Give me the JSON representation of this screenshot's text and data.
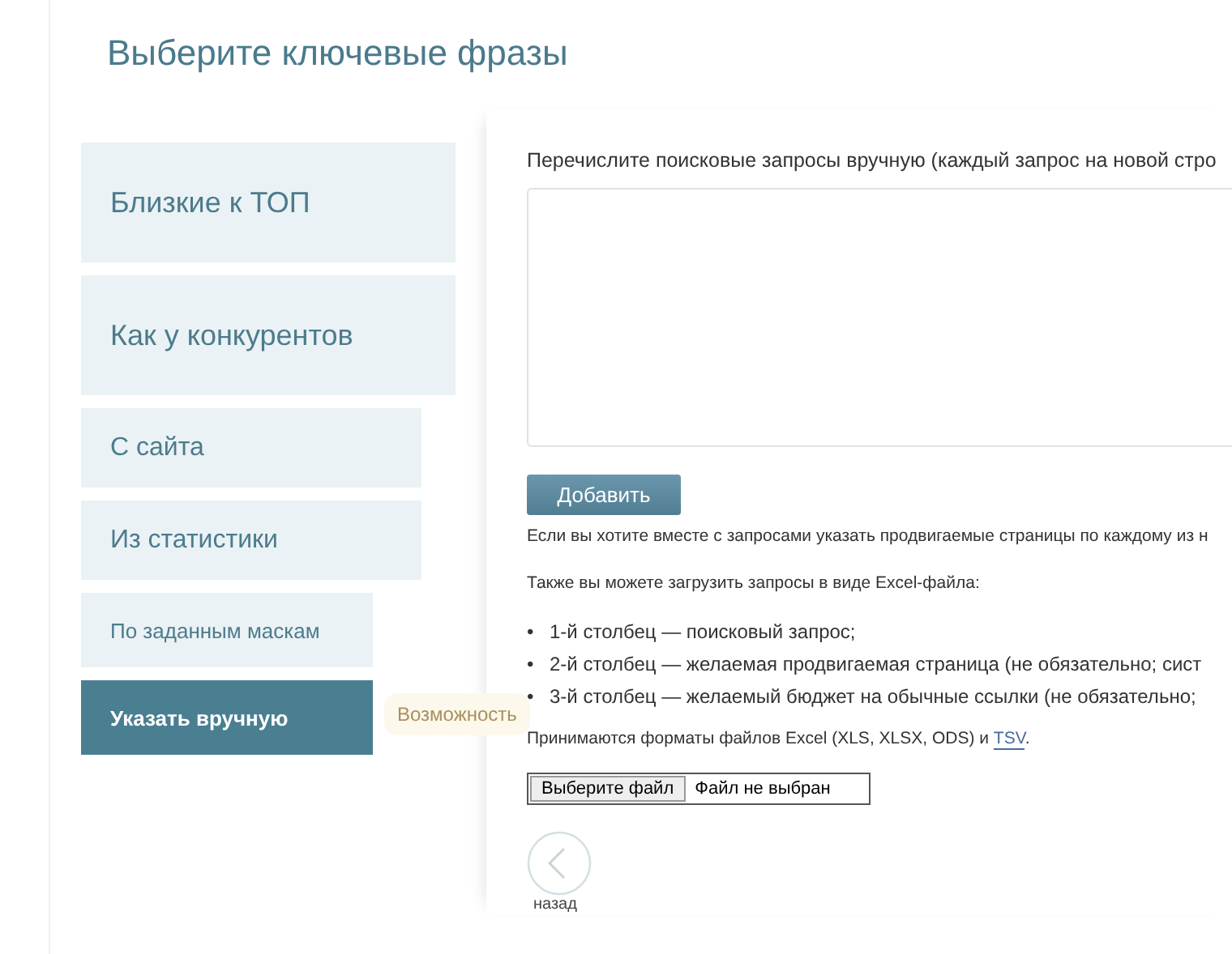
{
  "page_title": "Выберите ключевые фразы",
  "sidebar": {
    "items": [
      {
        "label": "Близкие к ТОП",
        "selected": false
      },
      {
        "label": "Как у конкурентов",
        "selected": false
      },
      {
        "label": "С сайта",
        "selected": false
      },
      {
        "label": "Из статистики",
        "selected": false
      },
      {
        "label": "По заданным маскам",
        "selected": false
      },
      {
        "label": "Указать вручную",
        "selected": true
      }
    ]
  },
  "tooltip": {
    "text": "Возможность"
  },
  "panel": {
    "intro": "Перечислите поисковые запросы вручную (каждый запрос на новой стро",
    "add_button": "Добавить",
    "note": "Если вы хотите вместе с запросами указать продвигаемые страницы по каждому из н",
    "excel_note": "Также вы можете загрузить запросы в виде Excel-файла:",
    "columns_list": [
      {
        "marker": "•",
        "text": "1-й столбец — поисковый запрос;"
      },
      {
        "marker": "•",
        "text": "2-й столбец — желаемая продвигаемая страница (не обязательно; сист"
      },
      {
        "marker": "•",
        "text": "3-й столбец — желаемый бюджет на обычные ссылки (не обязательно;"
      }
    ],
    "formats_text": "Принимаются форматы файлов Excel (XLS, XLSX, ODS) и ",
    "formats_link": "TSV",
    "formats_end": ".",
    "file_button": "Выберите файл",
    "file_status": "Файл не выбран",
    "back_label": "назад"
  }
}
